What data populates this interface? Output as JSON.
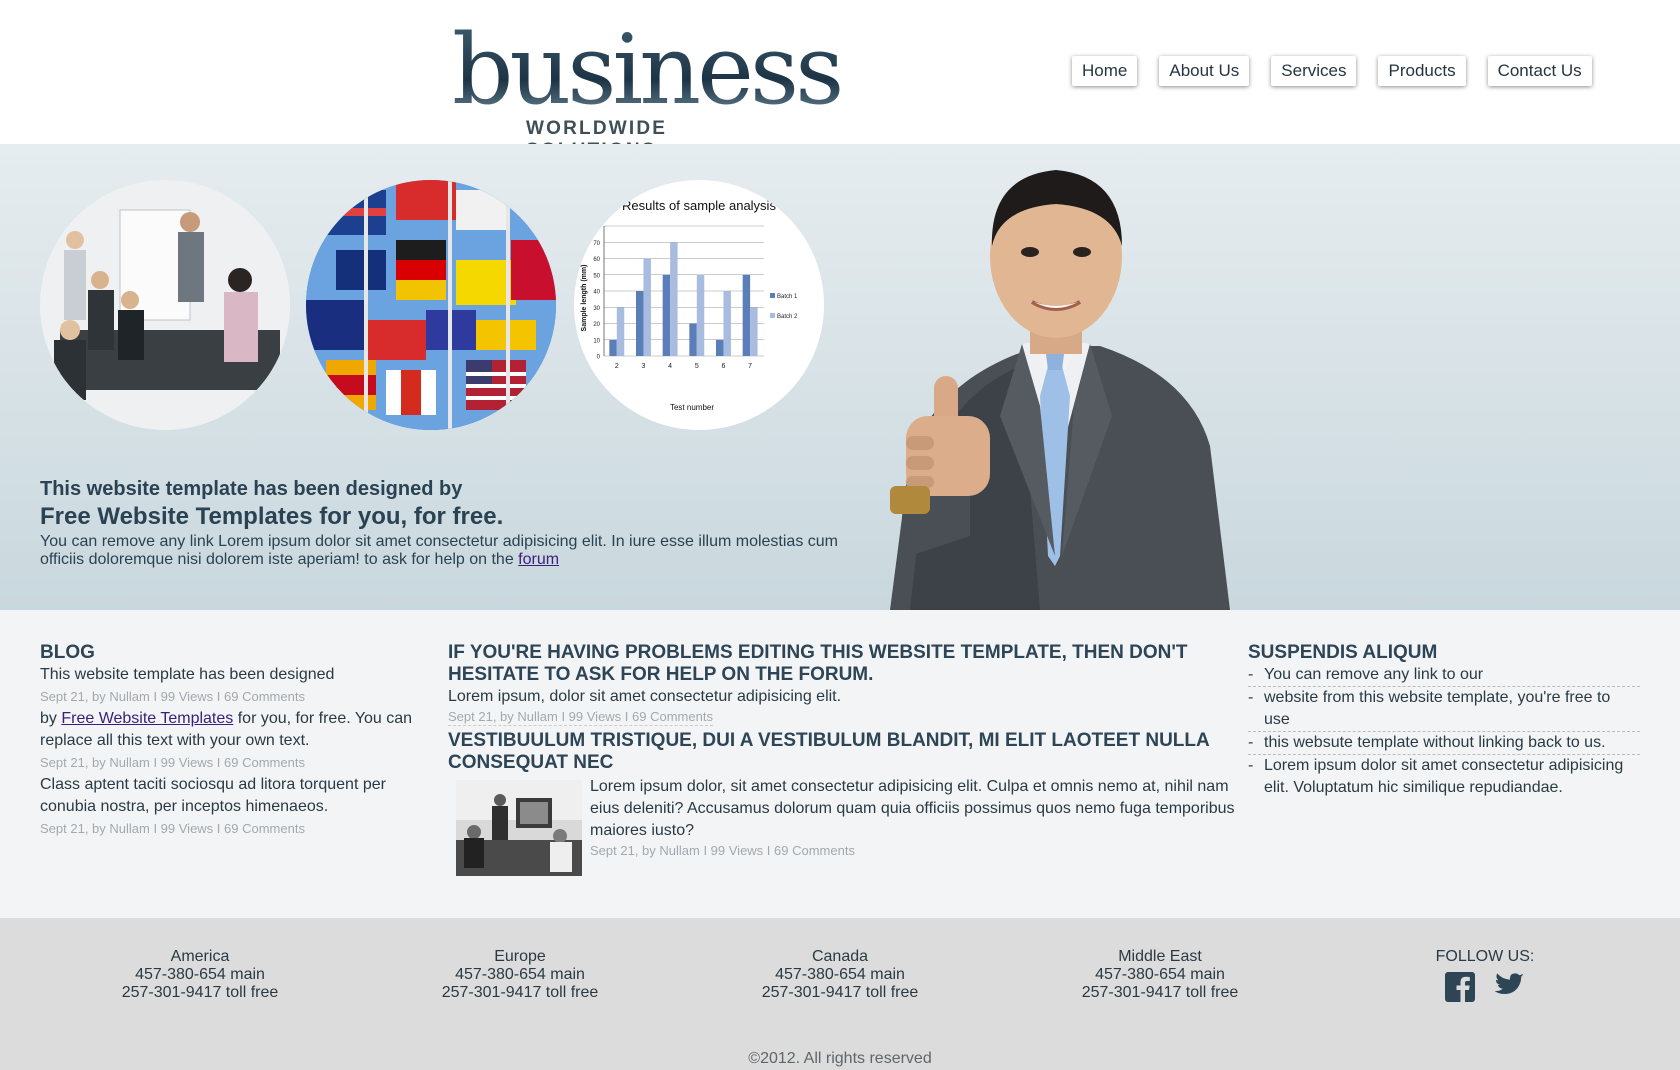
{
  "logo": {
    "word": "business",
    "tagline": "WORLDWIDE SOLUTIONS"
  },
  "nav": {
    "home": "Home",
    "about": "About Us",
    "services": "Services",
    "products": "Products",
    "contact": "Contact Us"
  },
  "hero": {
    "line1": "This website template has been designed by",
    "line2": "Free Website Templates for you, for free.",
    "body": "You can remove any link Lorem ipsum dolor sit amet consectetur adipisicing elit. In iure esse illum molestias cum officiis doloremque nisi dolorem iste aperiam! to ask for help on the ",
    "link": "forum"
  },
  "chart_data": {
    "type": "bar",
    "title": "Results of sample analysis",
    "xlabel": "Test number",
    "ylabel": "Sample length (mm)",
    "categories": [
      "2",
      "3",
      "4",
      "5",
      "6",
      "7"
    ],
    "series": [
      {
        "name": "Batch 1",
        "values": [
          10,
          40,
          50,
          20,
          10,
          50
        ]
      },
      {
        "name": "Batch 2",
        "values": [
          30,
          60,
          70,
          50,
          40,
          30
        ]
      }
    ],
    "ylim": [
      0,
      80
    ],
    "yticks": [
      "0",
      "10",
      "20",
      "30",
      "40",
      "50",
      "60",
      "70",
      "80"
    ],
    "legend": "right",
    "colors": [
      "#5a7fb8",
      "#a8bce0"
    ]
  },
  "blog": {
    "heading": "BLOG",
    "item1": "This website template has been designed",
    "meta1": "Sept 21, by Nullam I 99 Views I 69 Comments",
    "item2_pre": "by ",
    "item2_link": "Free Website Templates",
    "item2_post": " for you, for free. You can replace all this text with your own text.",
    "meta2": "Sept 21, by Nullam I 99 Views I 69 Comments",
    "item3": "Class aptent taciti sociosqu ad litora torquent per conubia nostra, per inceptos himenaeos.",
    "meta3": "Sept 21, by Nullam I 99 Views I 69 Comments"
  },
  "middle": {
    "heading1": "IF YOU'RE HAVING PROBLEMS EDITING THIS WEBSITE TEMPLATE, THEN DON'T HESITATE TO ASK FOR HELP ON THE FORUM.",
    "text1": "Lorem ipsum, dolor sit amet consectetur adipisicing elit.",
    "meta1": "Sept 21, by Nullam I 99 Views I 69 Comments",
    "heading2": "VESTIBUULUM TRISTIQUE, DUI A VESTIBULUM BLANDIT, MI ELIT LAOTEET NULLA CONSEQUAT NEC",
    "text2": "Lorem ipsum dolor, sit amet consectetur adipisicing elit. Culpa et omnis nemo at, nihil nam eius deleniti? Accusamus dolorum quam quia officiis possimus quos nemo fuga temporibus maiores iusto?",
    "meta2": "Sept 21, by Nullam I 99 Views I 69 Comments"
  },
  "right": {
    "heading": "SUSPENDIS ALIQUM",
    "items": [
      "You can remove any link to our",
      "website from this website template, you're free to use",
      "this websute template without linking back to us.",
      "Lorem ipsum dolor sit amet consectetur adipisicing elit. Voluptatum hic similique repudiandae."
    ]
  },
  "footer": {
    "offices": [
      {
        "region": "America",
        "main": "457-380-654 main",
        "tollfree": "257-301-9417 toll free"
      },
      {
        "region": "Europe",
        "main": "457-380-654 main",
        "tollfree": "257-301-9417 toll free"
      },
      {
        "region": "Canada",
        "main": "457-380-654 main",
        "tollfree": "257-301-9417 toll free"
      },
      {
        "region": "Middle East",
        "main": "457-380-654 main",
        "tollfree": "257-301-9417 toll free"
      }
    ],
    "follow": "FOLLOW US:",
    "copyright": "©2012. All rights reserved"
  },
  "icons": {
    "social": [
      "facebook-icon",
      "twitter-icon"
    ]
  },
  "colors": {
    "accent": "#2e4556",
    "heroTop": "#e6ecef",
    "heroBottom": "#c9d8de",
    "footer": "#dcdcdc"
  }
}
